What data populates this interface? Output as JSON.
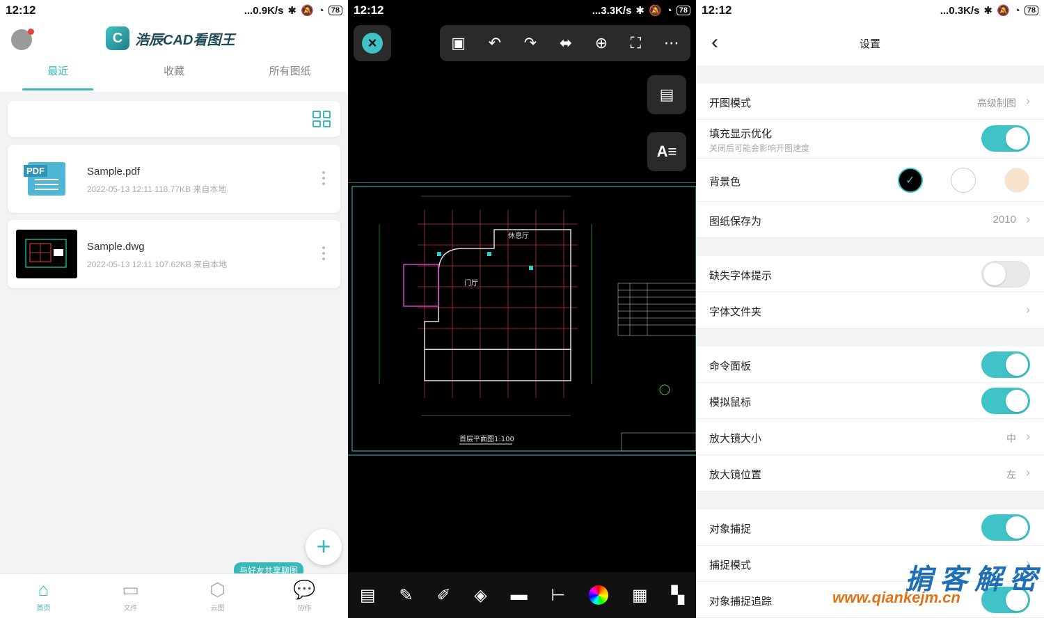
{
  "screen1": {
    "status": {
      "time": "12:12",
      "speed": "...0.9K/s",
      "battery": "78"
    },
    "logo_text": "浩辰CAD看图王",
    "tabs": [
      "最近",
      "收藏",
      "所有图纸"
    ],
    "files": [
      {
        "name": "Sample.pdf",
        "meta": "2022-05-13 12:11  118.77KB  来自本地",
        "thumb_tag": "PDF"
      },
      {
        "name": "Sample.dwg",
        "meta": "2022-05-13 12:11  107.62KB  来自本地"
      }
    ],
    "fab": "+",
    "chat_bubble": "与好友共享聊图",
    "nav": [
      {
        "label": "首页",
        "icon": "home-icon"
      },
      {
        "label": "文件",
        "icon": "folder-icon"
      },
      {
        "label": "云图",
        "icon": "cloud-icon"
      },
      {
        "label": "协作",
        "icon": "chat-icon"
      }
    ]
  },
  "screen2": {
    "status": {
      "time": "12:12",
      "speed": "...3.3K/s",
      "battery": "78"
    },
    "drawing_title": "首层平面图1:100",
    "room_labels": [
      "休息厅",
      "门厅"
    ]
  },
  "screen3": {
    "status": {
      "time": "12:12",
      "speed": "...0.3K/s",
      "battery": "78"
    },
    "title": "设置",
    "rows": {
      "open_mode": {
        "label": "开图模式",
        "value": "高级制图"
      },
      "fill_opt": {
        "label": "填充显示优化",
        "sub": "关闭后可能会影响开图速度",
        "on": true
      },
      "bg_color": {
        "label": "背景色",
        "colors": [
          "#000000",
          "#ffffff",
          "#f8e2cc"
        ]
      },
      "save_as": {
        "label": "图纸保存为",
        "value": "2010"
      },
      "missing_font": {
        "label": "缺失字体提示",
        "on": false
      },
      "font_folder": {
        "label": "字体文件夹"
      },
      "cmd_panel": {
        "label": "命令面板",
        "on": true
      },
      "sim_mouse": {
        "label": "模拟鼠标",
        "on": true
      },
      "mag_size": {
        "label": "放大镜大小",
        "value": "中"
      },
      "mag_pos": {
        "label": "放大镜位置",
        "value": "左"
      },
      "snap": {
        "label": "对象捕捉",
        "on": true
      },
      "snap_mode": {
        "label": "捕捉模式"
      },
      "snap_track": {
        "label": "对象捕捉追踪",
        "on": true
      }
    },
    "accent": "#3fc3c6"
  },
  "watermark": {
    "line1": "掮客解密",
    "line2": "www.qiankejm.cn"
  }
}
